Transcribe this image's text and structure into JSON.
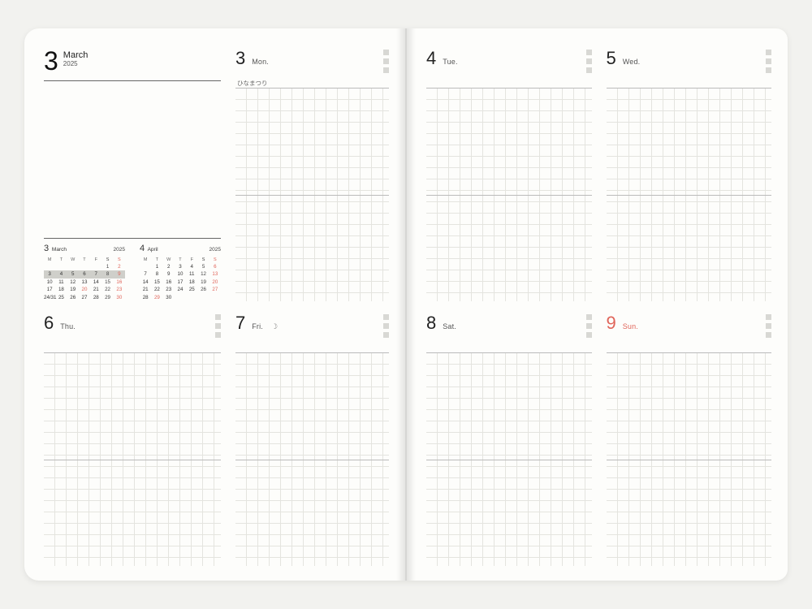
{
  "header": {
    "month_num": "3",
    "month_name": "March",
    "year": "2025"
  },
  "days": [
    {
      "num": "3",
      "wd": "Mon.",
      "holiday": "ひなまつり",
      "moon": ""
    },
    {
      "num": "4",
      "wd": "Tue.",
      "holiday": "",
      "moon": ""
    },
    {
      "num": "5",
      "wd": "Wed.",
      "holiday": "",
      "moon": ""
    },
    {
      "num": "6",
      "wd": "Thu.",
      "holiday": "",
      "moon": ""
    },
    {
      "num": "7",
      "wd": "Fri.",
      "holiday": "",
      "moon": "☽"
    },
    {
      "num": "8",
      "wd": "Sat.",
      "holiday": "",
      "moon": ""
    },
    {
      "num": "9",
      "wd": "Sun.",
      "holiday": "",
      "moon": "",
      "sunday": true
    }
  ],
  "mini": [
    {
      "num": "3",
      "name": "March",
      "year": "2025",
      "dow": [
        "M",
        "T",
        "W",
        "T",
        "F",
        "S",
        "S"
      ],
      "weeks": [
        [
          "",
          "",
          "",
          "",
          "",
          "1",
          "2"
        ],
        [
          "3",
          "4",
          "5",
          "6",
          "7",
          "8",
          "9"
        ],
        [
          "10",
          "11",
          "12",
          "13",
          "14",
          "15",
          "16"
        ],
        [
          "17",
          "18",
          "19",
          "20",
          "21",
          "22",
          "23"
        ],
        [
          "24/31",
          "25",
          "26",
          "27",
          "28",
          "29",
          "30"
        ]
      ],
      "highlight_row": 1,
      "holidays": [
        "20"
      ]
    },
    {
      "num": "4",
      "name": "April",
      "year": "2025",
      "dow": [
        "M",
        "T",
        "W",
        "T",
        "F",
        "S",
        "S"
      ],
      "weeks": [
        [
          "",
          "1",
          "2",
          "3",
          "4",
          "5",
          "6"
        ],
        [
          "7",
          "8",
          "9",
          "10",
          "11",
          "12",
          "13"
        ],
        [
          "14",
          "15",
          "16",
          "17",
          "18",
          "19",
          "20"
        ],
        [
          "21",
          "22",
          "23",
          "24",
          "25",
          "26",
          "27"
        ],
        [
          "28",
          "29",
          "30",
          "",
          "",
          "",
          ""
        ]
      ],
      "highlight_row": -1,
      "holidays": [
        "29"
      ]
    }
  ]
}
